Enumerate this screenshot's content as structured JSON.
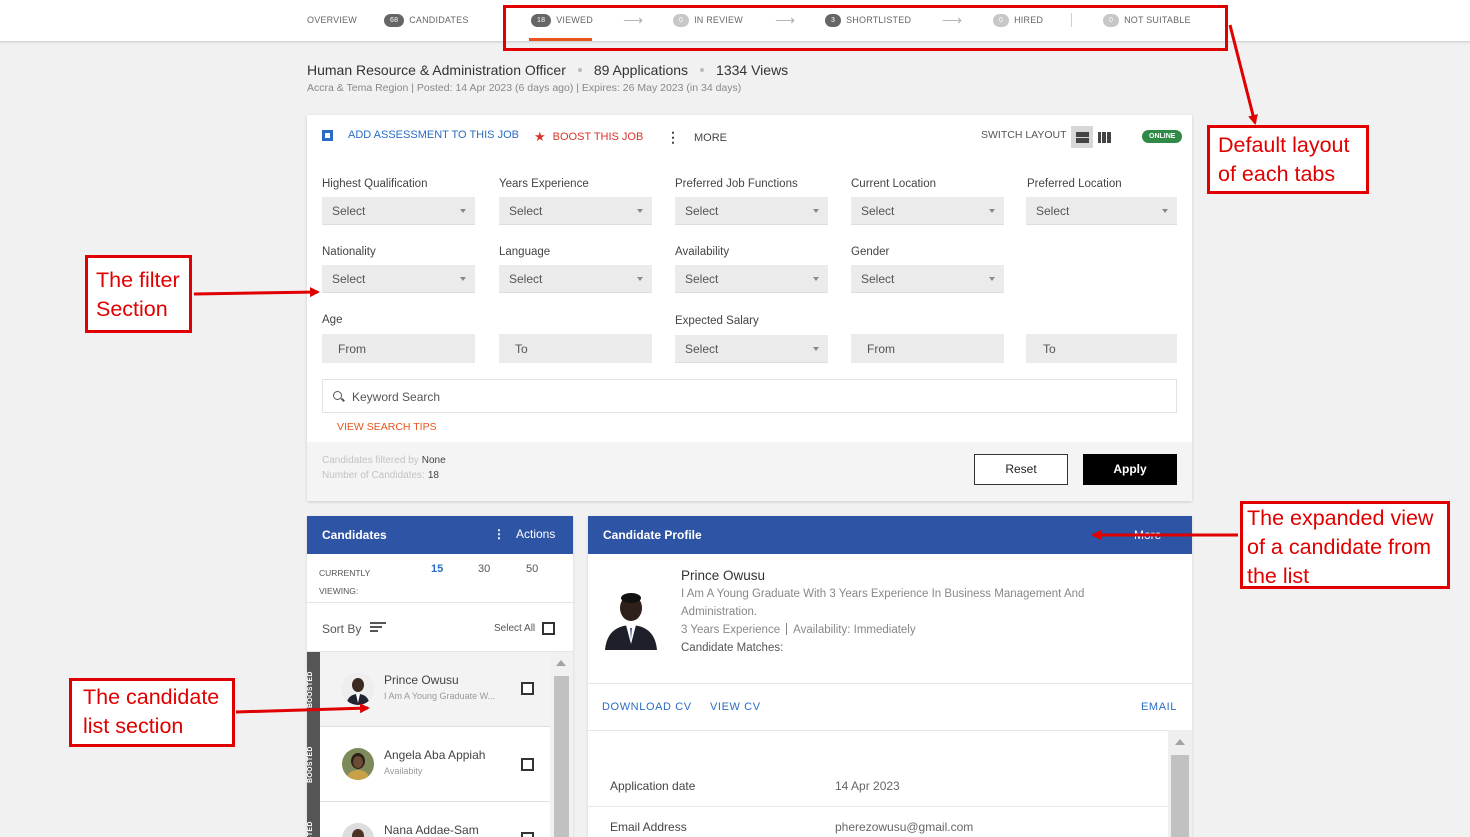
{
  "nav": {
    "overview": "OVERVIEW",
    "candidates": {
      "count": "68",
      "label": "CANDIDATES"
    },
    "viewed": {
      "count": "18",
      "label": "VIEWED"
    },
    "in_review": {
      "count": "0",
      "label": "IN REVIEW"
    },
    "shortlisted": {
      "count": "3",
      "label": "SHORTLISTED"
    },
    "hired": {
      "count": "0",
      "label": "HIRED"
    },
    "not_suitable": {
      "count": "0",
      "label": "NOT SUITABLE"
    },
    "arrow": "⟶",
    "active_color": "#e8541b"
  },
  "job": {
    "title": "Human Resource & Administration Officer",
    "applications": "89 Applications",
    "views": "1334 Views",
    "subtitle": "Accra & Tema Region | Posted: 14 Apr 2023 (6 days ago) | Expires: 26 May 2023 (in 34 days)"
  },
  "toolbar": {
    "add_assessment": "ADD ASSESSMENT TO THIS JOB",
    "boost": "BOOST THIS JOB",
    "more": "MORE",
    "switch_layout": "SWITCH LAYOUT",
    "online": "ONLINE",
    "icons": [
      "chart-icon",
      "star-icon",
      "kebab-icon",
      "rows-layout-icon",
      "columns-layout-icon"
    ]
  },
  "filters": {
    "highest_qualification": {
      "label": "Highest Qualification",
      "value": "Select"
    },
    "years_experience": {
      "label": "Years Experience",
      "value": "Select"
    },
    "preferred_job_functions": {
      "label": "Preferred Job Functions",
      "value": "Select"
    },
    "current_location": {
      "label": "Current Location",
      "value": "Select"
    },
    "preferred_location": {
      "label": "Preferred Location",
      "value": "Select"
    },
    "nationality": {
      "label": "Nationality",
      "value": "Select"
    },
    "language": {
      "label": "Language",
      "value": "Select"
    },
    "availability": {
      "label": "Availability",
      "value": "Select"
    },
    "gender": {
      "label": "Gender",
      "value": "Select"
    },
    "age": {
      "label": "Age",
      "from": "From",
      "to": "To"
    },
    "expected_salary": {
      "label": "Expected Salary",
      "value": "Select",
      "from": "From",
      "to": "To"
    },
    "keyword_placeholder": "Keyword Search",
    "view_search_tips": "VIEW SEARCH TIPS",
    "filtered_by_label": "Candidates filtered by",
    "filtered_by_value": "None",
    "number_label": "Number of Candidates:",
    "number_value": "18",
    "reset": "Reset",
    "apply": "Apply"
  },
  "candidates_panel": {
    "title": "Candidates",
    "actions": "Actions",
    "currently_viewing": "CURRENTLY VIEWING:",
    "page_sizes": [
      "15",
      "30",
      "50"
    ],
    "active_size_color": "#2b6cc4",
    "sort_by": "Sort By",
    "select_all": "Select All",
    "boosted": "BOOSTED",
    "items": [
      {
        "name": "Prince Owusu",
        "sub": "I Am A Young Graduate W..."
      },
      {
        "name": "Angela Aba Appiah",
        "sub": "Availabity"
      },
      {
        "name": "Nana Addae-Sam",
        "sub": ""
      }
    ]
  },
  "profile": {
    "header": "Candidate Profile",
    "more": "More",
    "name": "Prince Owusu",
    "summary": "I Am A Young Graduate With 3 Years Experience In Business Management And Administration.",
    "experience": "3 Years Experience",
    "availability": "Availability: Immediately",
    "matches": "Candidate Matches:",
    "download_cv": "DOWNLOAD CV",
    "view_cv": "VIEW CV",
    "email": "EMAIL",
    "details": [
      {
        "key": "Application date",
        "value": "14 Apr 2023"
      },
      {
        "key": "Email Address",
        "value": "pherezowusu@gmail.com"
      }
    ]
  },
  "annotations": {
    "default_layout": "Default layout of each tabs",
    "filter_section": "The filter Section",
    "expanded_view": "The expanded view of a candidate from the list",
    "candidate_list": "The candidate list section",
    "color": "#e00000"
  }
}
